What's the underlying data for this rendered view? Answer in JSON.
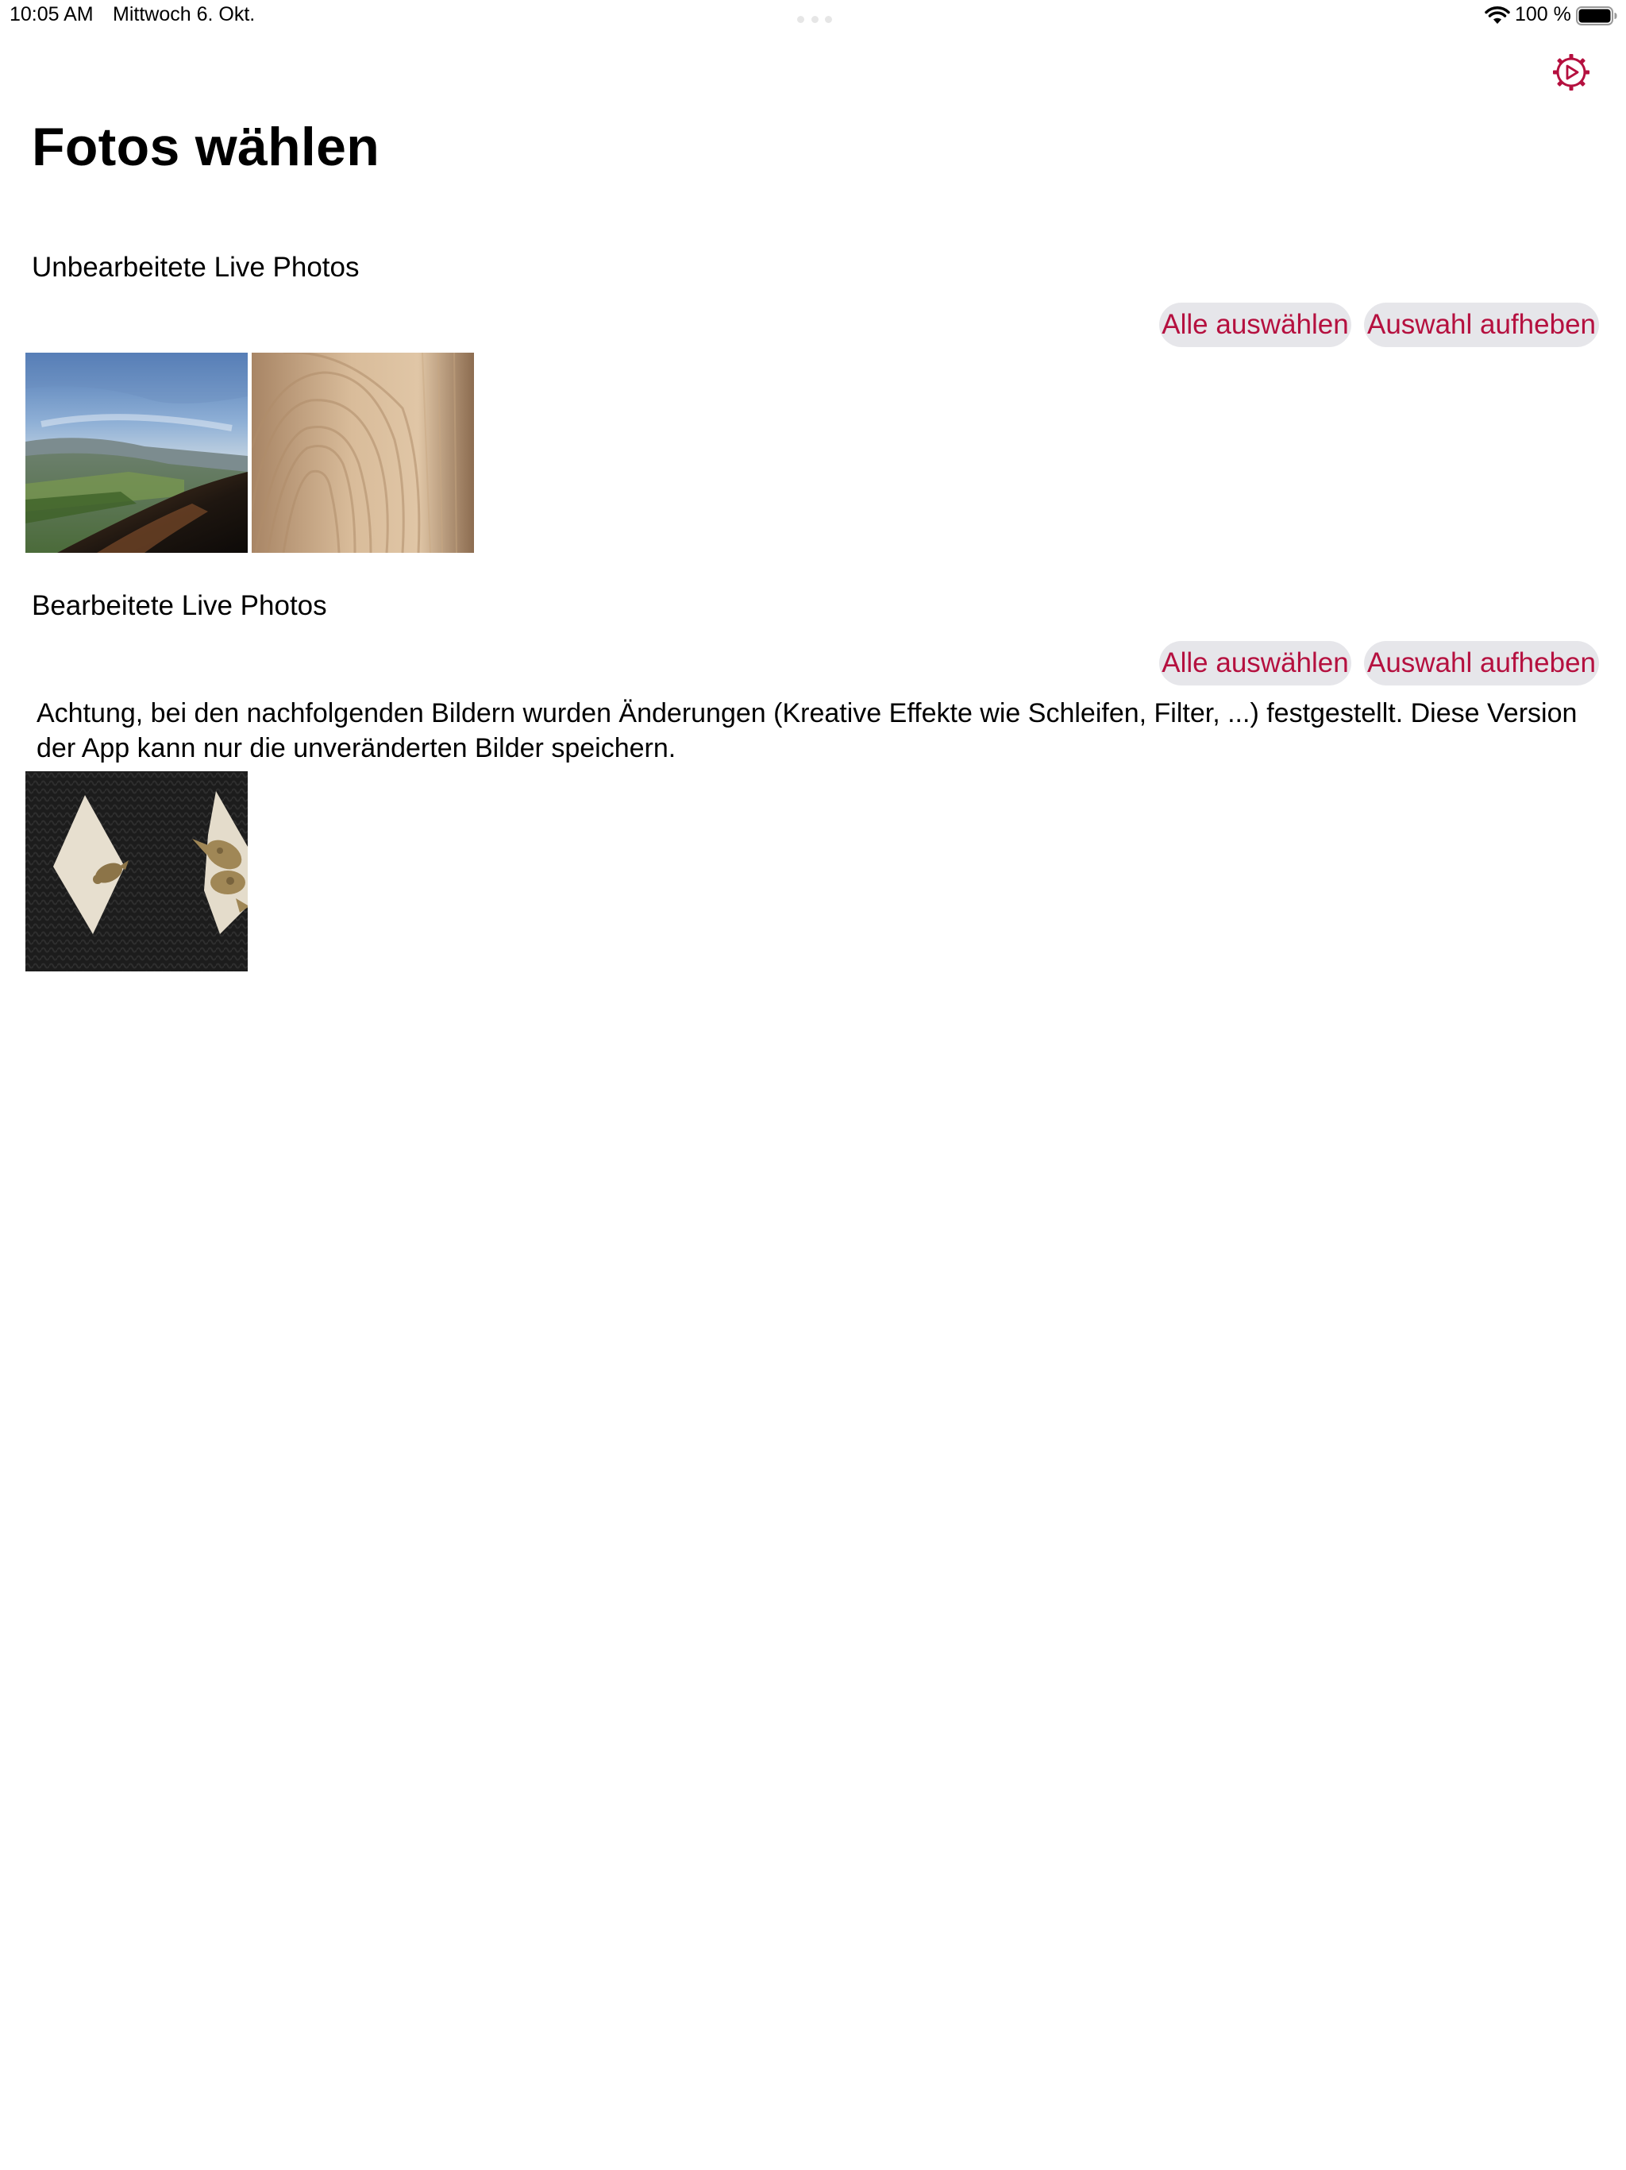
{
  "status_bar": {
    "time": "10:05 AM",
    "date": "Mittwoch 6. Okt.",
    "battery_percent": "100 %",
    "battery_level": 1.0,
    "icons": [
      "wifi-icon",
      "battery-icon"
    ]
  },
  "toolbar": {
    "settings_icon": "gear-play-icon",
    "accent_color": "#b5103f"
  },
  "page": {
    "title": "Fotos wählen"
  },
  "sections": [
    {
      "title": "Unbearbeitete Live Photos",
      "select_all_label": "Alle auswählen",
      "deselect_label": "Auswahl aufheben",
      "photos": [
        "landscape-valley-photo",
        "wood-grain-photo"
      ]
    },
    {
      "title": "Bearbeitete Live Photos",
      "select_all_label": "Alle auswählen",
      "deselect_label": "Auswahl aufheben",
      "warning": "Achtung, bei den nachfolgenden Bildern wurden Änderungen (Kreative Effekte wie Schleifen, Filter, ...) festgestellt. Diese Version der App kann nur die unveränderten Bilder speichern.",
      "photos": [
        "knit-fabric-figures-photo"
      ]
    }
  ],
  "colors": {
    "accent": "#b5103f",
    "button_background": "#e6e6ea",
    "background": "#ffffff"
  }
}
